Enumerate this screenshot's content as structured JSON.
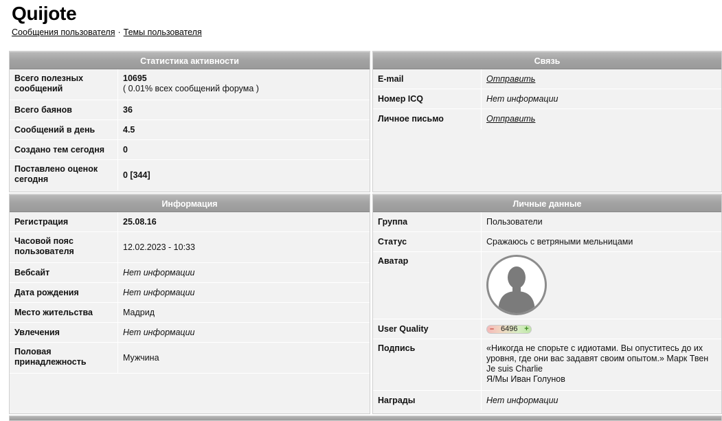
{
  "title": "Quijote",
  "links": {
    "messages": "Сообщения пользователя",
    "separator": "·",
    "topics": "Темы пользователя"
  },
  "activity": {
    "header": "Статистика активности",
    "rows": [
      {
        "label": "Всего полезных сообщений",
        "value": "10695",
        "sub": "( 0.01% всех сообщений форума )"
      },
      {
        "label": "Всего баянов",
        "value": "36"
      },
      {
        "label": "Сообщений в день",
        "value": "4.5"
      },
      {
        "label": "Создано тем сегодня",
        "value": "0"
      },
      {
        "label": "Поставлено оценок сегодня",
        "value": "0 [344]"
      }
    ]
  },
  "contact": {
    "header": "Связь",
    "rows": [
      {
        "label": "E-mail",
        "value": "Отправить"
      },
      {
        "label": "Номер ICQ",
        "value": "Нет информации"
      },
      {
        "label": "Личное письмо",
        "value": "Отправить"
      }
    ]
  },
  "info": {
    "header": "Информация",
    "rows": [
      {
        "label": "Регистрация",
        "value": "25.08.16"
      },
      {
        "label": "Часовой пояс пользователя",
        "value": "12.02.2023 - 10:33"
      },
      {
        "label": "Вебсайт",
        "value": "Нет информации"
      },
      {
        "label": "Дата рождения",
        "value": "Нет информации"
      },
      {
        "label": "Место жительства",
        "value": "Мадрид"
      },
      {
        "label": "Увлечения",
        "value": "Нет информации"
      },
      {
        "label": "Половая принадлежность",
        "value": "Мужчина"
      }
    ]
  },
  "personal": {
    "header": "Личные данные",
    "rows": [
      {
        "label": "Группа",
        "value": "Пользователи"
      },
      {
        "label": "Статус",
        "value": "Сражаюсь с ветряными мельницами"
      },
      {
        "label": "Аватар",
        "icon": "default-avatar-icon"
      },
      {
        "label": "User Quality",
        "minus": "–",
        "value": "6496",
        "plus": "+"
      },
      {
        "label": "Подпись",
        "lines": [
          "«Никогда не спорьте с идиотами. Вы опуститесь до их уровня, где они вас задавят своим опытом.» Марк Твен",
          "Je suis Charlie",
          "Я/Мы Иван Голунов"
        ]
      },
      {
        "label": "Награды",
        "value": "Нет информации"
      }
    ]
  }
}
